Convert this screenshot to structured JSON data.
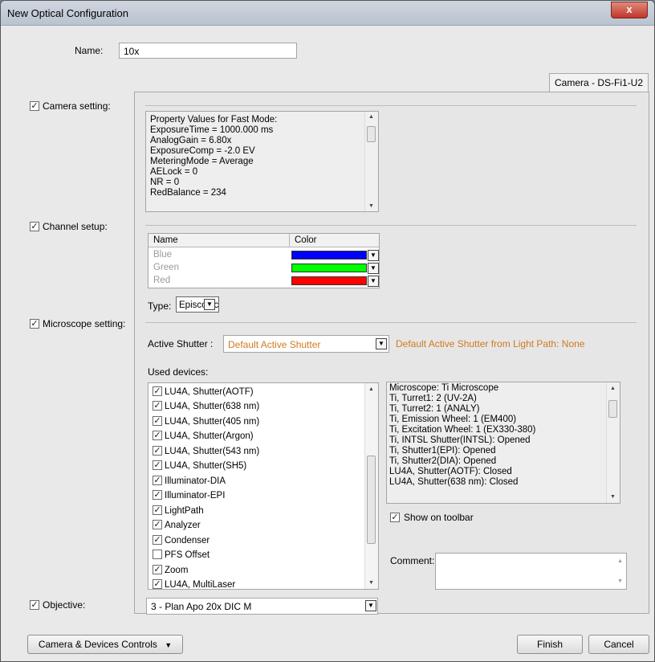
{
  "window": {
    "title": "New Optical Configuration",
    "close_glyph": "x"
  },
  "name_field": {
    "label": "Name:",
    "value": "10x"
  },
  "tab": {
    "label": "Camera - DS-Fi1-U2"
  },
  "sections": {
    "camera": {
      "label": "Camera setting:",
      "checked": true
    },
    "channel": {
      "label": "Channel setup:",
      "checked": true
    },
    "microscope": {
      "label": "Microscope setting:",
      "checked": true
    },
    "objective": {
      "label": "Objective:",
      "checked": true
    }
  },
  "camera_props": {
    "lines": [
      "Property Values for Fast Mode:",
      "ExposureTime = 1000.000 ms",
      "AnalogGain = 6.80x",
      "ExposureComp = -2.0 EV",
      "MeteringMode = Average",
      "AELock = 0",
      "NR = 0",
      "RedBalance = 234"
    ]
  },
  "channel_table": {
    "headers": {
      "name": "Name",
      "color": "Color"
    },
    "rows": [
      {
        "name": "Blue",
        "color": "#0000ff"
      },
      {
        "name": "Green",
        "color": "#00ff00"
      },
      {
        "name": "Red",
        "color": "#ff0000"
      }
    ]
  },
  "type_field": {
    "label": "Type:",
    "value": "Episcopic"
  },
  "shutter": {
    "label": "Active Shutter :",
    "value": "Default Active Shutter",
    "note": "Default Active Shutter from Light Path: None"
  },
  "used_devices": {
    "label": "Used devices:",
    "items": [
      {
        "label": "LU4A, Shutter(AOTF)",
        "checked": true
      },
      {
        "label": "LU4A, Shutter(638 nm)",
        "checked": true
      },
      {
        "label": "LU4A, Shutter(405 nm)",
        "checked": true
      },
      {
        "label": "LU4A, Shutter(Argon)",
        "checked": true
      },
      {
        "label": "LU4A, Shutter(543 nm)",
        "checked": true
      },
      {
        "label": "LU4A, Shutter(SH5)",
        "checked": true
      },
      {
        "label": "Illuminator-DIA",
        "checked": true
      },
      {
        "label": "Illuminator-EPI",
        "checked": true
      },
      {
        "label": "LightPath",
        "checked": true
      },
      {
        "label": "Analyzer",
        "checked": true
      },
      {
        "label": "Condenser",
        "checked": true
      },
      {
        "label": "PFS Offset",
        "checked": false
      },
      {
        "label": "Zoom",
        "checked": true
      },
      {
        "label": "LU4A, MultiLaser",
        "checked": true
      }
    ]
  },
  "microscope_info": {
    "lines": [
      "Microscope: Ti Microscope",
      "Ti, Turret1: 2 (UV-2A)",
      "Ti, Turret2: 1 (ANALY)",
      "Ti, Emission Wheel: 1 (EM400)",
      "Ti, Excitation Wheel: 1 (EX330-380)",
      "Ti, INTSL Shutter(INTSL): Opened",
      "Ti, Shutter1(EPI): Opened",
      "Ti, Shutter2(DIA): Opened",
      "LU4A, Shutter(AOTF): Closed",
      "LU4A, Shutter(638 nm): Closed"
    ]
  },
  "show_toolbar": {
    "label": "Show on toolbar",
    "checked": true
  },
  "comment": {
    "label": "Comment:",
    "value": ""
  },
  "objective": {
    "value": "3 - Plan Apo 20x DIC M"
  },
  "footer": {
    "controls_button": "Camera & Devices Controls",
    "finish_button": "Finish",
    "cancel_button": "Cancel"
  },
  "colors": {
    "accent_orange": "#d07a1e",
    "close_red": "#c1352a"
  }
}
